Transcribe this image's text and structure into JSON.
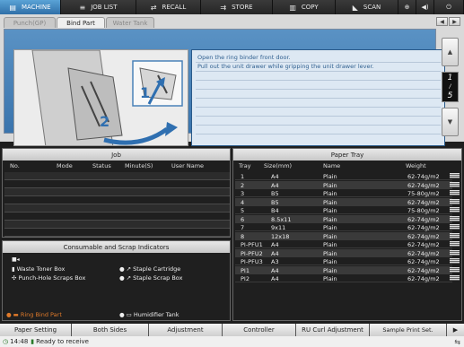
{
  "topbar": {
    "tabs": [
      {
        "label": "MACHINE",
        "icon": "printer-icon"
      },
      {
        "label": "JOB LIST",
        "icon": "list-icon"
      },
      {
        "label": "RECALL",
        "icon": "recall-icon"
      },
      {
        "label": "STORE",
        "icon": "store-icon"
      },
      {
        "label": "COPY",
        "icon": "copy-icon"
      },
      {
        "label": "SCAN",
        "icon": "scan-icon"
      }
    ]
  },
  "upper": {
    "tabs": [
      "Punch(GP)",
      "Bind Part",
      "Water Tank"
    ],
    "guide_lines": [
      "Open the ring binder front door.",
      "Pull out the unit drawer while gripping the unit drawer lever."
    ],
    "step_labels": [
      "1",
      "2"
    ],
    "page_current": "1",
    "page_total": "5"
  },
  "job": {
    "title": "Job",
    "columns": [
      "No.",
      "Mode",
      "Status",
      "Minute(S)",
      "User Name"
    ]
  },
  "consumables": {
    "title": "Consumable and Scrap Indicators",
    "items": [
      "Waste Toner Box",
      "Punch-Hole Scraps Box",
      "Staple Cartridge",
      "Staple Scrap Box",
      "Ring Bind Part",
      "Humidifier Tank"
    ]
  },
  "paper_tray": {
    "title": "Paper Tray",
    "columns": [
      "Tray",
      "Size(mm)",
      "Name",
      "Weight"
    ],
    "rows": [
      {
        "tray": "1",
        "size": "A4",
        "name": "Plain",
        "weight": "62-74g/m2"
      },
      {
        "tray": "2",
        "size": "A4",
        "name": "Plain",
        "weight": "62-74g/m2"
      },
      {
        "tray": "3",
        "size": "B5",
        "name": "Plain",
        "weight": "75-80g/m2"
      },
      {
        "tray": "4",
        "size": "B5",
        "name": "Plain",
        "weight": "62-74g/m2"
      },
      {
        "tray": "5",
        "size": "B4",
        "name": "Plain",
        "weight": "75-80g/m2"
      },
      {
        "tray": "6",
        "size": "8.5x11",
        "name": "Plain",
        "weight": "62-74g/m2"
      },
      {
        "tray": "7",
        "size": "9x11",
        "name": "Plain",
        "weight": "62-74g/m2"
      },
      {
        "tray": "8",
        "size": "12x18",
        "name": "Plain",
        "weight": "62-74g/m2"
      },
      {
        "tray": "PI-PFU1",
        "size": "A4",
        "name": "Plain",
        "weight": "62-74g/m2"
      },
      {
        "tray": "PI-PFU2",
        "size": "A4",
        "name": "Plain",
        "weight": "62-74g/m2"
      },
      {
        "tray": "PI-PFU3",
        "size": "A3",
        "name": "Plain",
        "weight": "62-74g/m2"
      },
      {
        "tray": "PI1",
        "size": "A4",
        "name": "Plain",
        "weight": "62-74g/m2"
      },
      {
        "tray": "PI2",
        "size": "A4",
        "name": "Plain",
        "weight": "62-74g/m2"
      }
    ]
  },
  "bottombar": {
    "buttons": [
      "Paper Setting",
      "Both Sides",
      "Adjustment",
      "Controller",
      "RU Curl Adjustment",
      "Sample Print Set."
    ]
  },
  "status": {
    "time": "14:48",
    "text": "Ready to receive"
  },
  "colors": {
    "accent": "#3a74ad",
    "warning": "#e07a2a"
  }
}
